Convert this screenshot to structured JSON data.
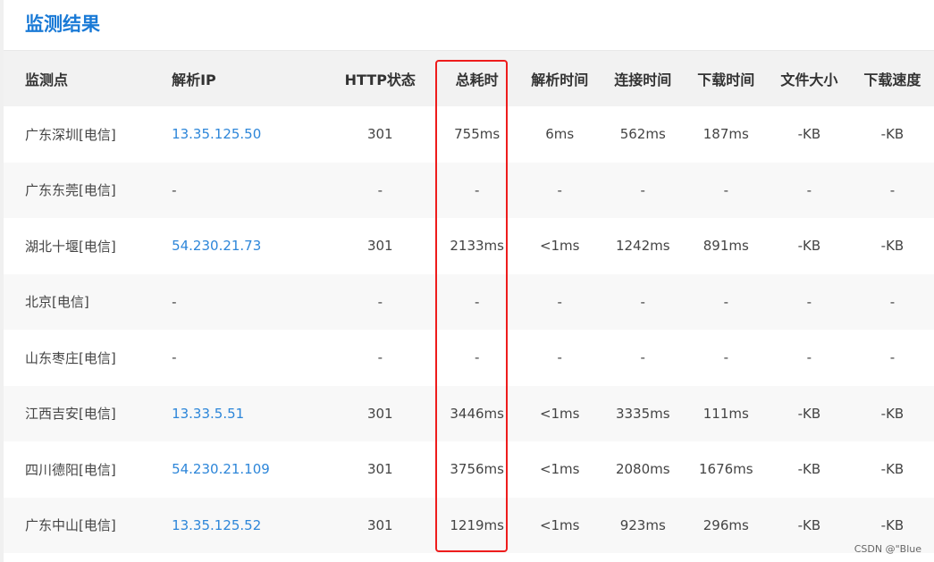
{
  "page": {
    "title": "监测结果",
    "watermark": "CSDN @\"Blue"
  },
  "colors": {
    "title": "#1a7ad6",
    "link": "#2d86d9",
    "highlight": "#ee1c1c",
    "header_bg": "#f2f2f2",
    "row_alt_bg": "#f8f8f8"
  },
  "table": {
    "headers": {
      "node": "监测点",
      "ip": "解析IP",
      "http_status": "HTTP状态",
      "total_time": "总耗时",
      "resolve_time": "解析时间",
      "connect_time": "连接时间",
      "download_time": "下载时间",
      "file_size": "文件大小",
      "download_speed": "下载速度"
    },
    "rows": [
      {
        "node": "广东深圳[电信]",
        "ip": "13.35.125.50",
        "http_status": "301",
        "total_time": "755ms",
        "resolve_time": "6ms",
        "connect_time": "562ms",
        "download_time": "187ms",
        "file_size": "-KB",
        "download_speed": "-KB"
      },
      {
        "node": "广东东莞[电信]",
        "ip": "-",
        "http_status": "-",
        "total_time": "-",
        "resolve_time": "-",
        "connect_time": "-",
        "download_time": "-",
        "file_size": "-",
        "download_speed": "-"
      },
      {
        "node": "湖北十堰[电信]",
        "ip": "54.230.21.73",
        "http_status": "301",
        "total_time": "2133ms",
        "resolve_time": "<1ms",
        "connect_time": "1242ms",
        "download_time": "891ms",
        "file_size": "-KB",
        "download_speed": "-KB"
      },
      {
        "node": "北京[电信]",
        "ip": "-",
        "http_status": "-",
        "total_time": "-",
        "resolve_time": "-",
        "connect_time": "-",
        "download_time": "-",
        "file_size": "-",
        "download_speed": "-"
      },
      {
        "node": "山东枣庄[电信]",
        "ip": "-",
        "http_status": "-",
        "total_time": "-",
        "resolve_time": "-",
        "connect_time": "-",
        "download_time": "-",
        "file_size": "-",
        "download_speed": "-"
      },
      {
        "node": "江西吉安[电信]",
        "ip": "13.33.5.51",
        "http_status": "301",
        "total_time": "3446ms",
        "resolve_time": "<1ms",
        "connect_time": "3335ms",
        "download_time": "111ms",
        "file_size": "-KB",
        "download_speed": "-KB"
      },
      {
        "node": "四川德阳[电信]",
        "ip": "54.230.21.109",
        "http_status": "301",
        "total_time": "3756ms",
        "resolve_time": "<1ms",
        "connect_time": "2080ms",
        "download_time": "1676ms",
        "file_size": "-KB",
        "download_speed": "-KB"
      },
      {
        "node": "广东中山[电信]",
        "ip": "13.35.125.52",
        "http_status": "301",
        "total_time": "1219ms",
        "resolve_time": "<1ms",
        "connect_time": "923ms",
        "download_time": "296ms",
        "file_size": "-KB",
        "download_speed": "-KB"
      }
    ]
  }
}
